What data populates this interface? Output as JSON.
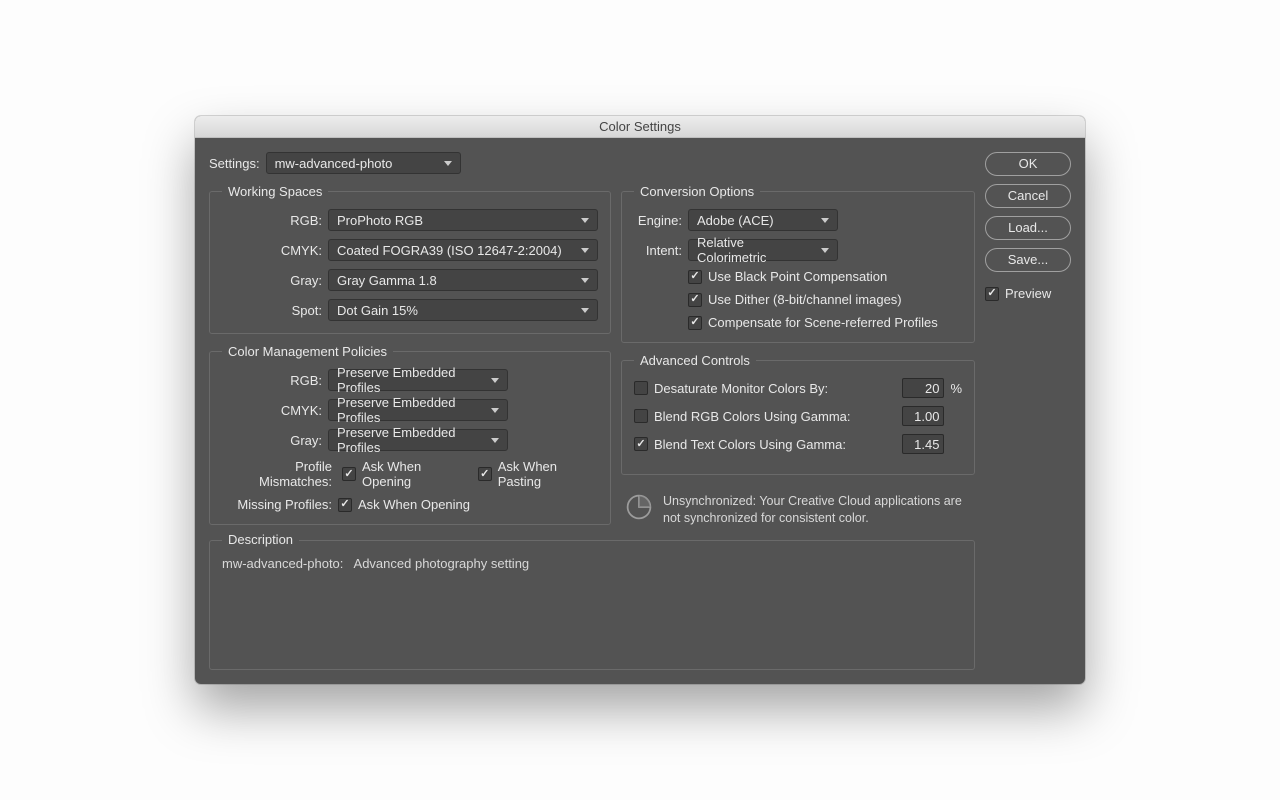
{
  "title": "Color Settings",
  "settings_label": "Settings:",
  "settings_value": "mw-advanced-photo",
  "buttons": {
    "ok": "OK",
    "cancel": "Cancel",
    "load": "Load...",
    "save": "Save..."
  },
  "preview_label": "Preview",
  "working_spaces": {
    "legend": "Working Spaces",
    "rgb_label": "RGB:",
    "rgb_value": "ProPhoto RGB",
    "cmyk_label": "CMYK:",
    "cmyk_value": "Coated FOGRA39 (ISO 12647-2:2004)",
    "gray_label": "Gray:",
    "gray_value": "Gray Gamma 1.8",
    "spot_label": "Spot:",
    "spot_value": "Dot Gain 15%"
  },
  "policies": {
    "legend": "Color Management Policies",
    "rgb_label": "RGB:",
    "rgb_value": "Preserve Embedded Profiles",
    "cmyk_label": "CMYK:",
    "cmyk_value": "Preserve Embedded Profiles",
    "gray_label": "Gray:",
    "gray_value": "Preserve Embedded Profiles",
    "mismatch_label": "Profile Mismatches:",
    "ask_open": "Ask When Opening",
    "ask_paste": "Ask When Pasting",
    "missing_label": "Missing Profiles:",
    "missing_ask": "Ask When Opening"
  },
  "conversion": {
    "legend": "Conversion Options",
    "engine_label": "Engine:",
    "engine_value": "Adobe (ACE)",
    "intent_label": "Intent:",
    "intent_value": "Relative Colorimetric",
    "bpc": "Use Black Point Compensation",
    "dither": "Use Dither (8-bit/channel images)",
    "scene": "Compensate for Scene-referred Profiles"
  },
  "advanced": {
    "legend": "Advanced Controls",
    "desat_label": "Desaturate Monitor Colors By:",
    "desat_value": "20",
    "desat_unit": "%",
    "blend_rgb_label": "Blend RGB Colors Using Gamma:",
    "blend_rgb_value": "1.00",
    "blend_text_label": "Blend Text Colors Using Gamma:",
    "blend_text_value": "1.45"
  },
  "sync": {
    "text": "Unsynchronized: Your Creative Cloud applications are not synchronized for consistent color."
  },
  "description": {
    "legend": "Description",
    "name": "mw-advanced-photo:",
    "text": "Advanced photography setting"
  }
}
